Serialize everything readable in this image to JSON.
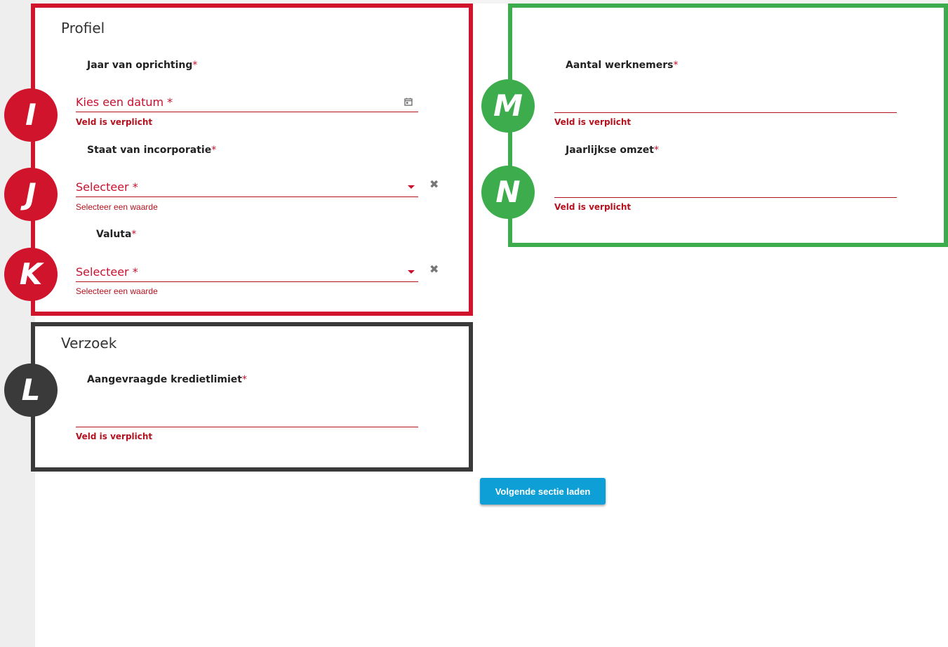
{
  "profiel": {
    "title": "Profiel",
    "founding_year": {
      "label": "Jaar van oprichting",
      "required_mark": "*",
      "placeholder": "Kies een datum",
      "placeholder_required": "*",
      "error": "Veld is verplicht",
      "icon": "calendar-icon"
    },
    "incorporation_state": {
      "label": "Staat van incorporatie",
      "required_mark": "*",
      "placeholder": "Selecteer",
      "placeholder_required": "*",
      "error": "Selecteer een waarde",
      "icons": [
        "dropdown-caret-icon",
        "clear-icon"
      ]
    },
    "currency": {
      "label": "Valuta",
      "required_mark": "*",
      "placeholder": "Selecteer",
      "placeholder_required": "*",
      "error": "Selecteer een waarde",
      "icons": [
        "dropdown-caret-icon",
        "clear-icon"
      ]
    }
  },
  "company": {
    "employees": {
      "label": "Aantal werknemers",
      "required_mark": "*",
      "value": "",
      "error": "Veld is verplicht"
    },
    "revenue": {
      "label": "Jaarlijkse omzet",
      "required_mark": "*",
      "value": "",
      "error": "Veld is verplicht"
    }
  },
  "verzoek": {
    "title": "Verzoek",
    "credit_limit": {
      "label": "Aangevraagde kredietlimiet",
      "required_mark": "*",
      "value": "",
      "error": "Veld is verplicht"
    }
  },
  "markers": {
    "i": "I",
    "j": "J",
    "k": "K",
    "l": "L",
    "m": "M",
    "n": "N"
  },
  "next_button": "Volgende sectie laden",
  "colors": {
    "red_highlight": "#d0142c",
    "green_highlight": "#3cac4c",
    "dark_highlight": "#3a3a3a",
    "error": "#b3121f",
    "button": "#0d9fd6"
  }
}
